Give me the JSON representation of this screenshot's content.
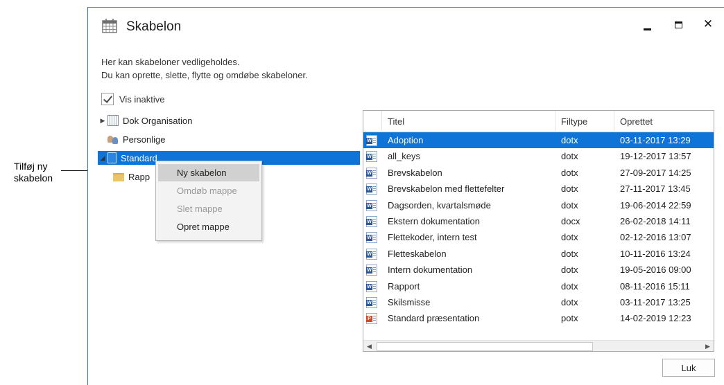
{
  "callout": {
    "line1": "Tilføj ny",
    "line2": "skabelon"
  },
  "window": {
    "title": "Skabelon",
    "app_icon": "calendar-grid-icon",
    "controls": {
      "minimize": "minimize-icon",
      "maximize": "maximize-icon",
      "close": "✕"
    }
  },
  "description": {
    "line1": "Her kan skabeloner vedligeholdes.",
    "line2": "Du kan oprette, slette, flytte og omdøbe skabeloner."
  },
  "show_inactive": {
    "label": "Vis inaktive",
    "checked": true
  },
  "tree": {
    "items": [
      {
        "label": "Dok Organisation",
        "icon": "building-icon",
        "expander": "▶"
      },
      {
        "label": "Personlige",
        "icon": "people-icon",
        "expander": ""
      },
      {
        "label": "Standard",
        "icon": "document-icon",
        "expander": "◢",
        "selected": true
      },
      {
        "label": "Rapp",
        "icon": "folder-icon",
        "expander": ""
      }
    ]
  },
  "context_menu": {
    "items": [
      {
        "label": "Ny skabelon",
        "enabled": true,
        "hovered": true
      },
      {
        "label": "Omdøb mappe",
        "enabled": false
      },
      {
        "label": "Slet mappe",
        "enabled": false
      },
      {
        "label": "Opret mappe",
        "enabled": true
      }
    ]
  },
  "table": {
    "columns": [
      "Titel",
      "Filtype",
      "Oprettet"
    ],
    "rows": [
      {
        "icon": "word",
        "title": "Adoption",
        "type": "dotx",
        "created": "03-11-2017 13:29",
        "selected": true
      },
      {
        "icon": "word",
        "title": "all_keys",
        "type": "dotx",
        "created": "19-12-2017 13:57"
      },
      {
        "icon": "word",
        "title": "Brevskabelon",
        "type": "dotx",
        "created": "27-09-2017 14:25"
      },
      {
        "icon": "word",
        "title": "Brevskabelon med flettefelter",
        "type": "dotx",
        "created": "27-11-2017 13:45"
      },
      {
        "icon": "word",
        "title": "Dagsorden, kvartalsmøde",
        "type": "dotx",
        "created": "19-06-2014 22:59"
      },
      {
        "icon": "word",
        "title": "Ekstern dokumentation",
        "type": "docx",
        "created": "26-02-2018 14:11"
      },
      {
        "icon": "word",
        "title": "Flettekoder, intern test",
        "type": "dotx",
        "created": "02-12-2016 13:07"
      },
      {
        "icon": "word",
        "title": "Fletteskabelon",
        "type": "dotx",
        "created": "10-11-2016 13:24"
      },
      {
        "icon": "word",
        "title": "Intern dokumentation",
        "type": "dotx",
        "created": "19-05-2016 09:00"
      },
      {
        "icon": "word",
        "title": "Rapport",
        "type": "dotx",
        "created": "08-11-2016 15:11"
      },
      {
        "icon": "word",
        "title": "Skilsmisse",
        "type": "dotx",
        "created": "03-11-2017 13:25"
      },
      {
        "icon": "powerpoint",
        "title": "Standard præsentation",
        "type": "potx",
        "created": "14-02-2019 12:23"
      }
    ]
  },
  "close_button": {
    "label": "Luk"
  },
  "colors": {
    "selection": "#0f74d8",
    "window_border": "#2b79d6"
  }
}
